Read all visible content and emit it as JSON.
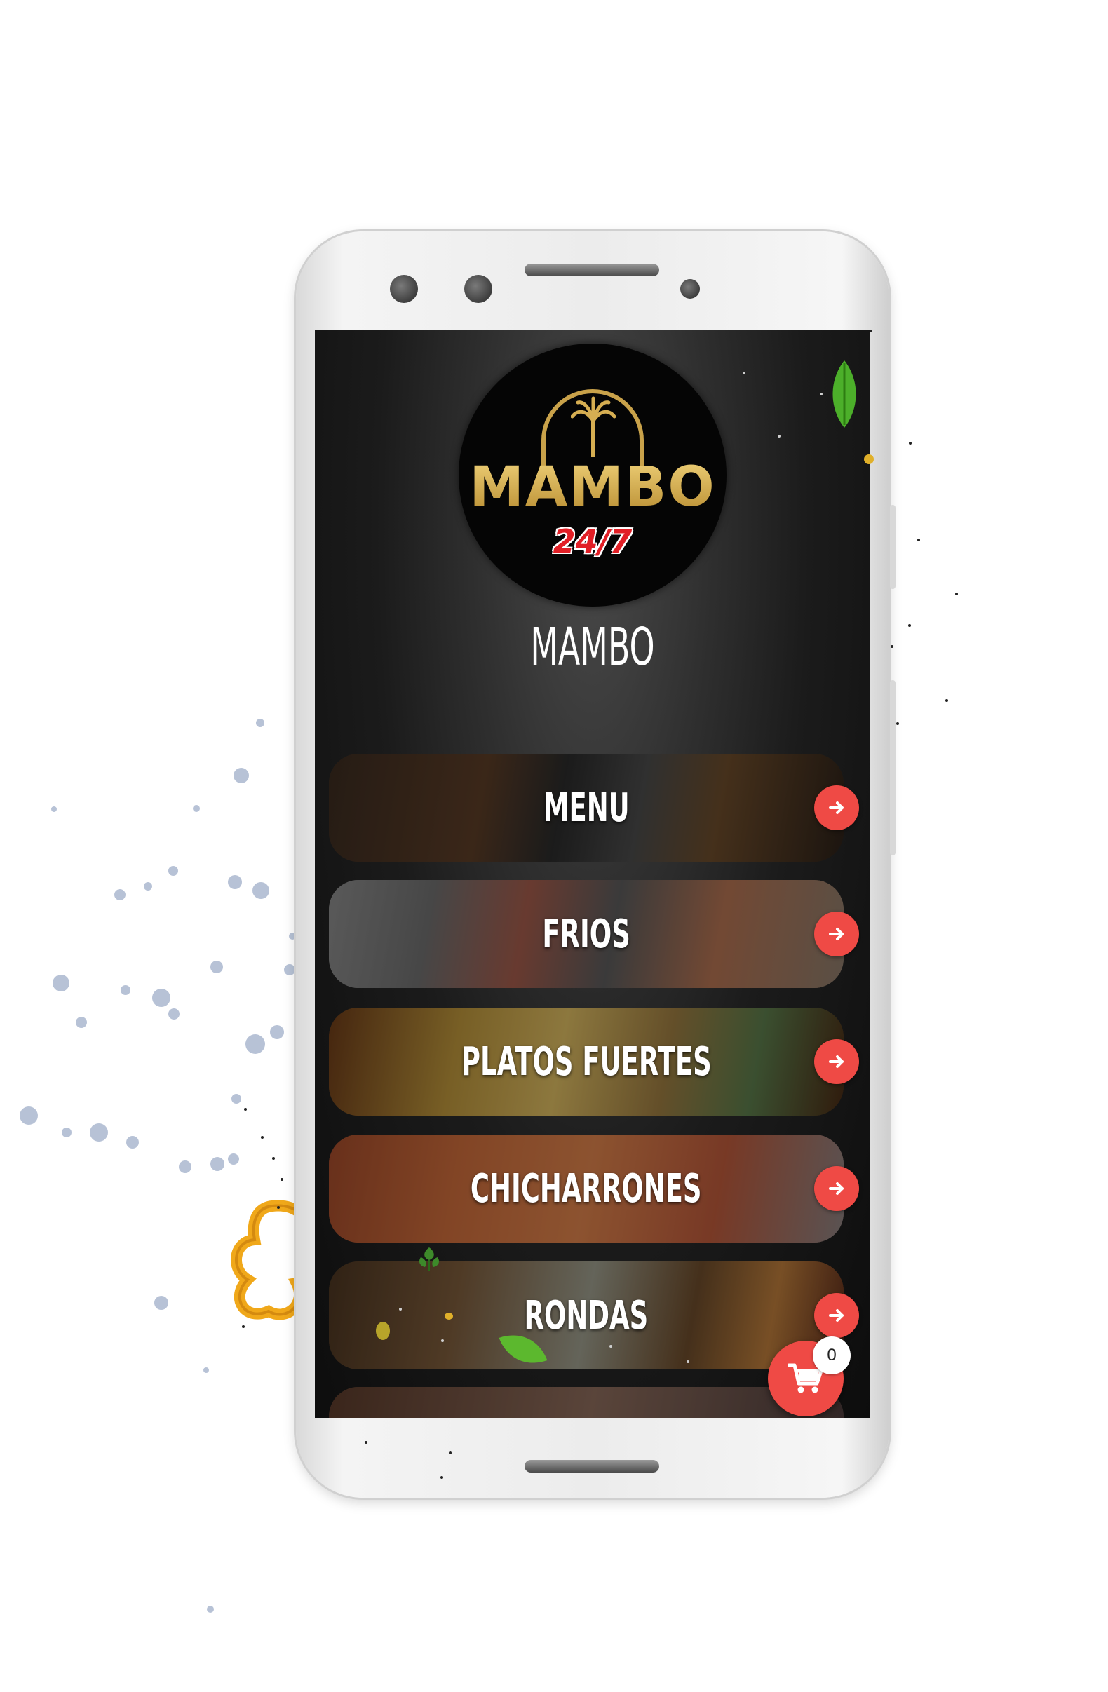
{
  "app": {
    "logo": {
      "wordmark": "MAMBO",
      "tagline": "24/7",
      "gold": "#d6ae52",
      "red": "#e21f26"
    },
    "brand_title": "MAMBO"
  },
  "categories": [
    {
      "label": "MENU",
      "icon": "arrow-right-icon"
    },
    {
      "label": "FRIOS",
      "icon": "arrow-right-icon"
    },
    {
      "label": "PLATOS FUERTES",
      "icon": "arrow-right-icon"
    },
    {
      "label": "CHICHARRONES",
      "icon": "arrow-right-icon"
    },
    {
      "label": "RONDAS",
      "icon": "arrow-right-icon"
    }
  ],
  "cart": {
    "icon": "shopping-cart-icon",
    "count": "0"
  },
  "colors": {
    "accent": "#ef4a45",
    "screen_bg": "#1b1b1b",
    "text": "#ffffff"
  }
}
